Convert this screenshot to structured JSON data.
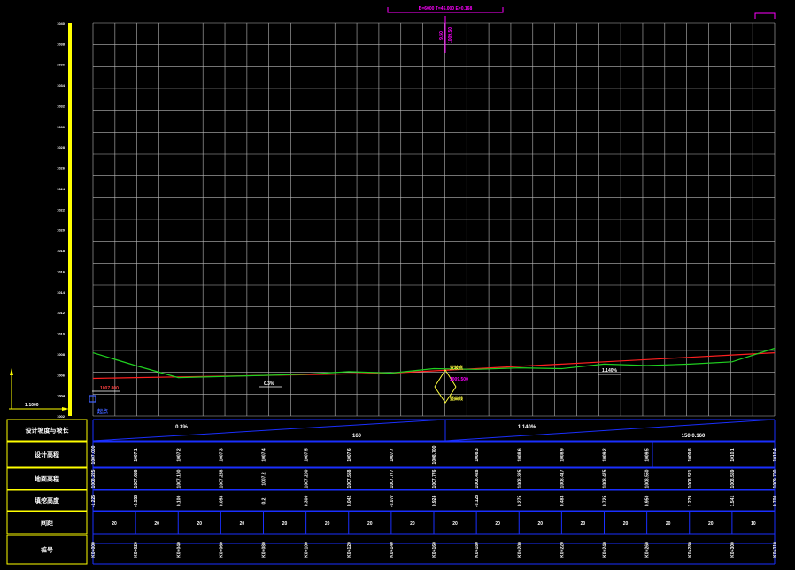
{
  "colors": {
    "background": "#000000",
    "grid": "#b8b8b8",
    "scale_yellow": "#ffff00",
    "design_line": "#ff2020",
    "ground_line": "#20d020",
    "table_blue": "#1a2fff",
    "text_white": "#ffffff",
    "magenta": "#ff00ff",
    "label_yellow": "#ffff40"
  },
  "top_label": "B=6000 T=45.000 E=0.168",
  "vertical_curve_label": [
    "9.50",
    "1009.50"
  ],
  "scale_label": "1:1000",
  "start_label": "起点",
  "axis_ticks": [
    "1040",
    "1038",
    "1036",
    "1034",
    "1032",
    "1030",
    "1028",
    "1026",
    "1024",
    "1022",
    "1020",
    "1018",
    "1016",
    "1014",
    "1012",
    "1010",
    "1008",
    "1006",
    "1004",
    "1002"
  ],
  "annotations": [
    {
      "text": "1007.800"
    },
    {
      "text": "0.3%"
    },
    {
      "text": "变坡点"
    },
    {
      "text": "1009.500"
    },
    {
      "text": "竖曲线"
    },
    {
      "text": "1.140%"
    }
  ],
  "table": {
    "row_labels": [
      "设计坡度与坡长",
      "设计高程",
      "地面高程",
      "填挖高度",
      "间距",
      "桩号"
    ],
    "slope_segments": [
      {
        "grade": "0.3%",
        "length": "160"
      },
      {
        "grade": "1.140%",
        "length": "150 0.160"
      }
    ],
    "design_elev": [
      "1007.000",
      "1007.1",
      "1007.2",
      "1007.3",
      "1007.4",
      "1007.5",
      "1007.6",
      "1007.7",
      "1008.700",
      "1008.3",
      "1008.6",
      "1008.9",
      "1009.2",
      "1009.5",
      "1009.8",
      "1010.1",
      "1010.4"
    ],
    "ground_elev": [
      "1008.225",
      "1007.658",
      "1007.100",
      "1007.258",
      "1007.2",
      "1007.200",
      "1007.558",
      "1007.777",
      "1007.776",
      "1008.428",
      "1008.325",
      "1008.417",
      "1008.475",
      "1008.550",
      "1008.521",
      "1008.559",
      "1009.700"
    ],
    "fill_cut": [
      "-1.225",
      "-0.558",
      "0.100",
      "0.058",
      "0.2",
      "0.300",
      "0.042",
      "-0.077",
      "0.924",
      "-0.128",
      "0.275",
      "0.483",
      "0.725",
      "0.950",
      "1.279",
      "1.541",
      "0.700"
    ],
    "spacing": [
      "20",
      "20",
      "20",
      "20",
      "20",
      "20",
      "20",
      "20",
      "20",
      "20",
      "20",
      "20",
      "20",
      "20",
      "20",
      "10"
    ],
    "stations": [
      "K0+000",
      "K0+020",
      "K0+040",
      "K0+060",
      "K0+080",
      "K0+100",
      "K0+120",
      "K0+140",
      "K0+160",
      "K0+180",
      "K0+200",
      "K0+220",
      "K0+240",
      "K0+260",
      "K0+280",
      "K0+300",
      "K0+310"
    ]
  },
  "chart_data": {
    "type": "line",
    "xlabel": "",
    "ylabel": "",
    "ylim": [
      1002,
      1040
    ],
    "x": [
      "K0+000",
      "K0+020",
      "K0+040",
      "K0+060",
      "K0+080",
      "K0+100",
      "K0+120",
      "K0+140",
      "K0+160",
      "K0+180",
      "K0+200",
      "K0+220",
      "K0+240",
      "K0+260",
      "K0+280",
      "K0+300",
      "K0+310"
    ],
    "series": [
      {
        "values": [
          1007.0,
          1007.1,
          1007.2,
          1007.3,
          1007.4,
          1007.5,
          1007.6,
          1007.7,
          1008.0,
          1008.3,
          1008.6,
          1008.9,
          1009.2,
          1009.5,
          1009.8,
          1010.1,
          1010.4
        ]
      },
      {
        "values": [
          1010.4,
          1008.7,
          1007.1,
          1007.25,
          1007.4,
          1007.55,
          1007.9,
          1007.7,
          1008.3,
          1008.2,
          1008.4,
          1008.3,
          1008.9,
          1008.7,
          1008.9,
          1009.2,
          1011.0
        ]
      }
    ],
    "grid": true
  }
}
